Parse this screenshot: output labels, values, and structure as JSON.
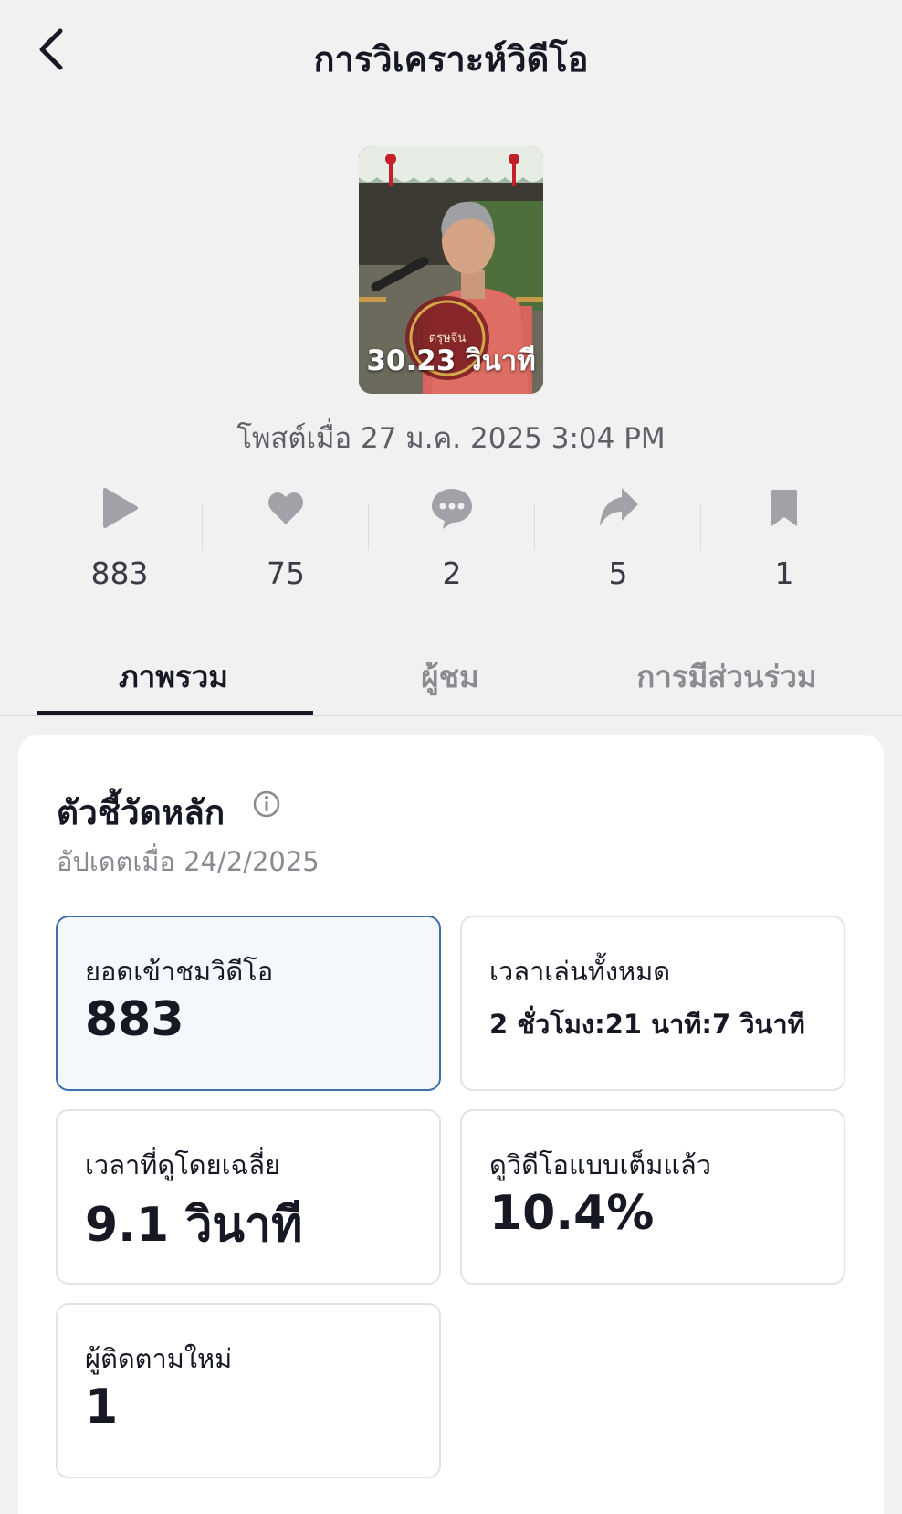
{
  "header": {
    "title": "การวิเคราะห์วิดีโอ",
    "back_icon": "chevron-left-icon"
  },
  "video": {
    "duration": "30.23 วินาที",
    "posted": "โพสต์เมื่อ 27 ม.ค. 2025 3:04 PM"
  },
  "stats": [
    {
      "icon": "play-icon",
      "value": "883"
    },
    {
      "icon": "heart-icon",
      "value": "75"
    },
    {
      "icon": "comment-icon",
      "value": "2"
    },
    {
      "icon": "share-icon",
      "value": "5"
    },
    {
      "icon": "bookmark-icon",
      "value": "1"
    }
  ],
  "tabs": [
    {
      "label": "ภาพรวม",
      "active": true
    },
    {
      "label": "ผู้ชม",
      "active": false
    },
    {
      "label": "การมีส่วนร่วม",
      "active": false
    }
  ],
  "key_metrics": {
    "title": "ตัวชี้วัดหลัก",
    "updated": "อัปเดตเมื่อ 24/2/2025",
    "items": [
      {
        "label": "ยอดเข้าชมวิดีโอ",
        "value": "883",
        "selected": true
      },
      {
        "label": "เวลาเล่นทั้งหมด",
        "value": "2 ชั่วโมง:21 นาที:7 วินาที",
        "selected": false
      },
      {
        "label": "เวลาที่ดูโดยเฉลี่ย",
        "value": "9.1 วินาที",
        "selected": false
      },
      {
        "label": "ดูวิดีโอแบบเต็มแล้ว",
        "value": "10.4%",
        "selected": false
      },
      {
        "label": "ผู้ติดตามใหม่",
        "value": "1",
        "selected": false
      }
    ]
  },
  "colors": {
    "accent_border": "#3b6faa",
    "icon_gray": "#a1a2a8",
    "text_dark": "#161823"
  }
}
